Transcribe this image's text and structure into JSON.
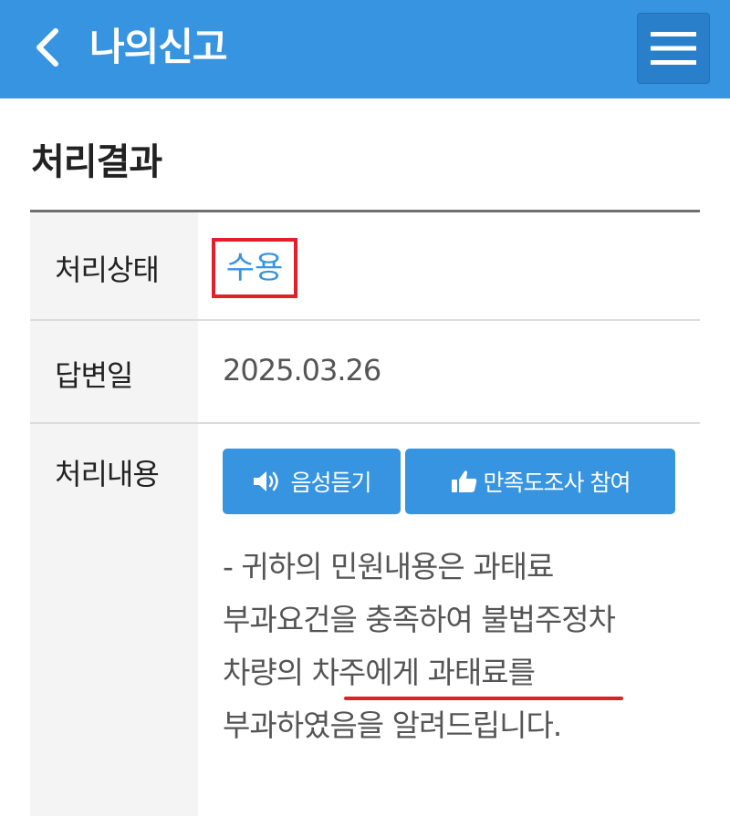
{
  "header": {
    "title": "나의신고",
    "back_icon": "chevron-left-icon",
    "menu_icon": "hamburger-menu-icon",
    "background": "#3794e0"
  },
  "section": {
    "title": "처리결과"
  },
  "rows": {
    "status": {
      "label": "처리상태",
      "value": "수용",
      "highlight_color": "#e0202a",
      "value_color": "#3794e0"
    },
    "answer_date": {
      "label": "답변일",
      "value": "2025.03.26"
    },
    "content": {
      "label": "처리내용",
      "listen_button": "음성듣기",
      "listen_icon": "speaker-icon",
      "survey_button": "만족도조사 참여",
      "survey_icon": "thumbs-up-icon",
      "text": "- 귀하의 민원내용은 과태료 부과요건을 충족하여 불법주정차 차량의 차주에게 과태료를 부과하였음을 알려드립니다."
    }
  }
}
